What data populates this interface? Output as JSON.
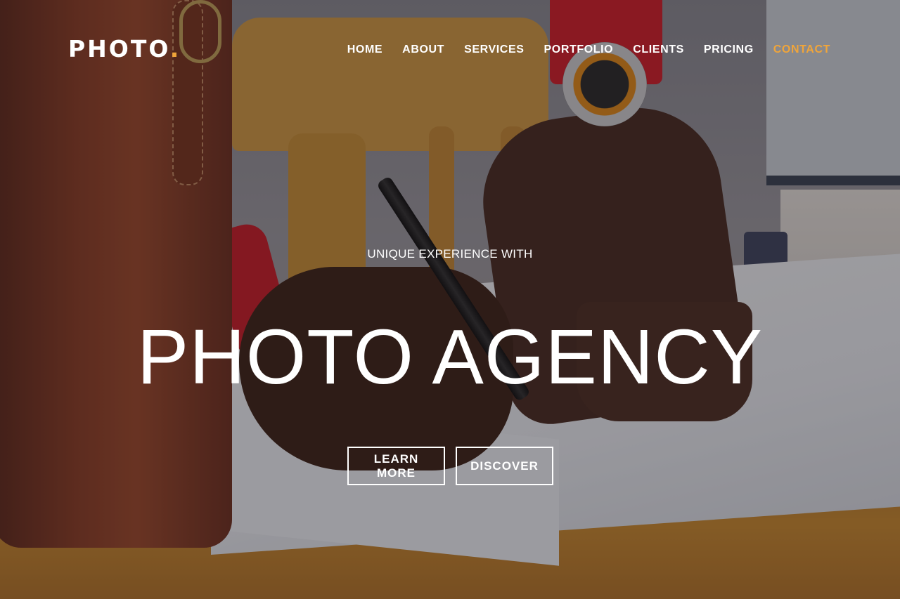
{
  "brand": {
    "name": "PHOTO",
    "dot": "."
  },
  "nav": {
    "items": [
      {
        "label": "HOME"
      },
      {
        "label": "ABOUT"
      },
      {
        "label": "SERVICES"
      },
      {
        "label": "PORTFOLIO"
      },
      {
        "label": "CLIENTS"
      },
      {
        "label": "PRICING"
      },
      {
        "label": "CONTACT",
        "active": true
      }
    ]
  },
  "hero": {
    "kicker": "UNIQUE EXPERIENCE WITH",
    "title": "PHOTO AGENCY",
    "buttons": {
      "learn_more": "LEARN MORE",
      "discover": "DISCOVER"
    }
  },
  "colors": {
    "accent": "#f0a53a",
    "text": "#ffffff"
  }
}
